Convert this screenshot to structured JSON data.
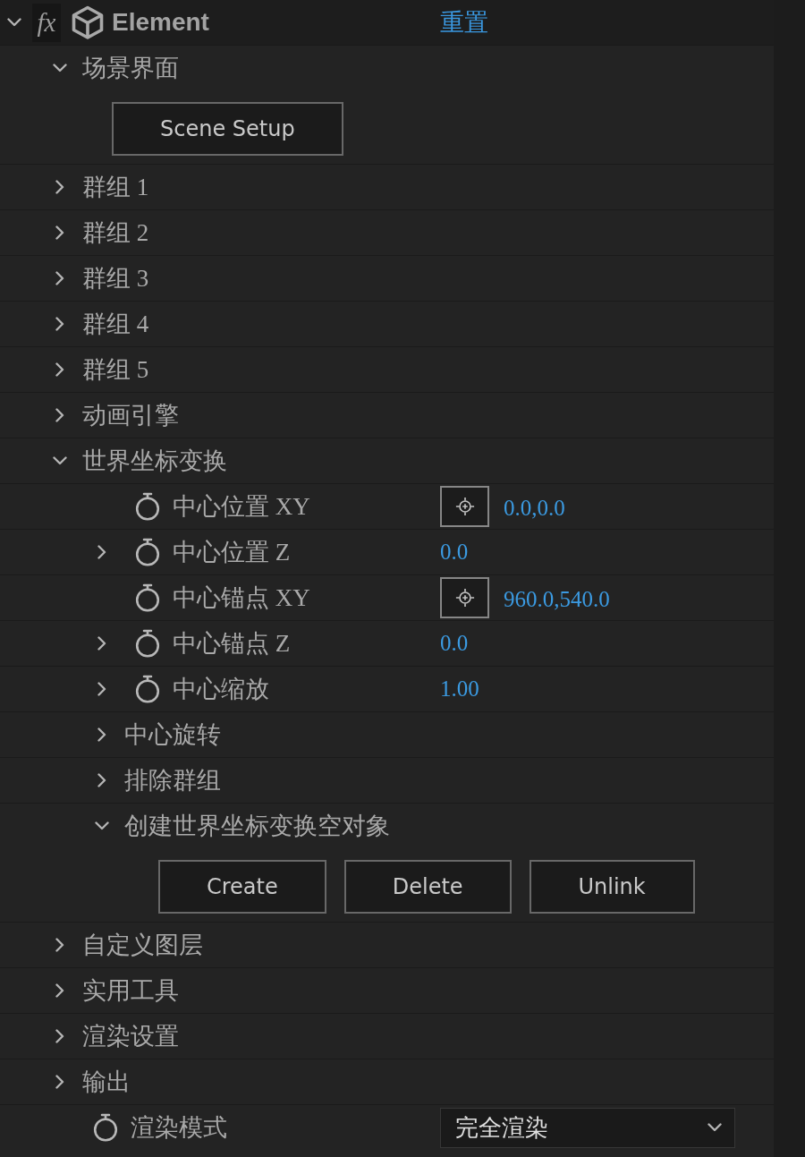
{
  "effect": {
    "expanded": true,
    "badge": "fx",
    "name": "Element",
    "reset_link": "重置",
    "children": [
      {
        "kind": "group",
        "label": "场景界面",
        "expanded": true,
        "children": [
          {
            "kind": "buttons",
            "buttons": [
              "Scene Setup"
            ]
          }
        ]
      },
      {
        "kind": "group",
        "label": "群组 1",
        "expanded": false
      },
      {
        "kind": "group",
        "label": "群组 2",
        "expanded": false
      },
      {
        "kind": "group",
        "label": "群组 3",
        "expanded": false
      },
      {
        "kind": "group",
        "label": "群组 4",
        "expanded": false
      },
      {
        "kind": "group",
        "label": "群组 5",
        "expanded": false
      },
      {
        "kind": "group",
        "label": "动画引擎",
        "expanded": false
      },
      {
        "kind": "group",
        "label": "世界坐标变换",
        "expanded": true,
        "children": [
          {
            "kind": "point",
            "label": "中心位置 XY",
            "value": "0.0,0.0"
          },
          {
            "kind": "number",
            "label": "中心位置 Z",
            "value": "0.0",
            "expanded": false
          },
          {
            "kind": "point",
            "label": "中心锚点 XY",
            "value": "960.0,540.0"
          },
          {
            "kind": "number",
            "label": "中心锚点 Z",
            "value": "0.0",
            "expanded": false
          },
          {
            "kind": "number",
            "label": "中心缩放",
            "value": "1.00",
            "expanded": false
          },
          {
            "kind": "group",
            "label": "中心旋转",
            "expanded": false
          },
          {
            "kind": "group",
            "label": "排除群组",
            "expanded": false
          },
          {
            "kind": "group",
            "label": "创建世界坐标变换空对象",
            "expanded": true,
            "children": [
              {
                "kind": "buttons",
                "buttons": [
                  "Create",
                  "Delete",
                  "Unlink"
                ]
              }
            ]
          }
        ]
      },
      {
        "kind": "group",
        "label": "自定义图层",
        "expanded": false
      },
      {
        "kind": "group",
        "label": "实用工具",
        "expanded": false
      },
      {
        "kind": "group",
        "label": "渲染设置",
        "expanded": false
      },
      {
        "kind": "group",
        "label": "输出",
        "expanded": false
      },
      {
        "kind": "dropdown",
        "label": "渲染模式",
        "value": "完全渲染"
      }
    ]
  }
}
